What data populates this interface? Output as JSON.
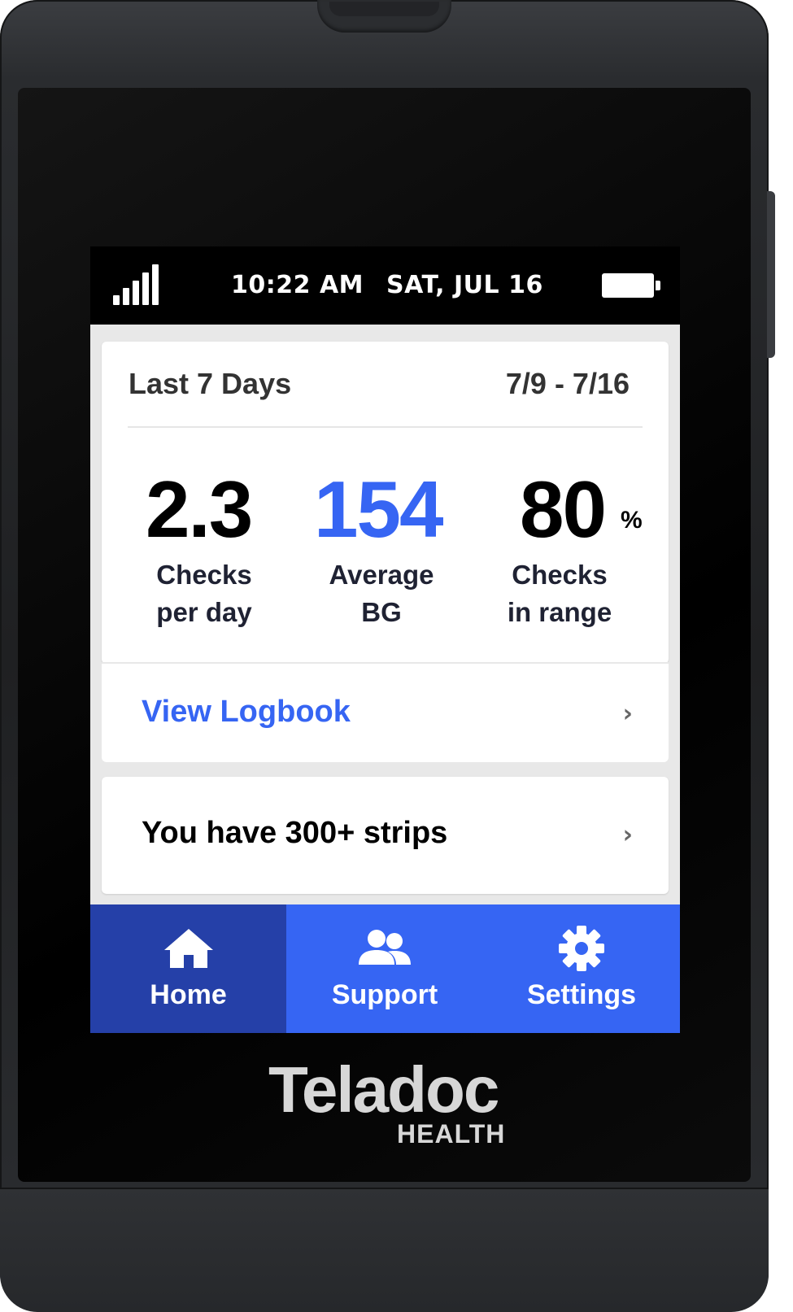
{
  "status_bar": {
    "time": "10:22 AM",
    "date": "SAT, JUL 16",
    "signal_icon": "signal-bars-icon",
    "battery_icon": "battery-full-icon"
  },
  "summary": {
    "period_label": "Last 7 Days",
    "date_range": "7/9 - 7/16",
    "stats": [
      {
        "value": "2.3",
        "label_line1": "Checks",
        "label_line2": "per day",
        "color": "#000000"
      },
      {
        "value": "154",
        "label_line1": "Average",
        "label_line2": "BG",
        "color": "#3665f3"
      },
      {
        "value": "80",
        "unit": "%",
        "label_line1": "Checks",
        "label_line2": "in range",
        "color": "#000000"
      }
    ]
  },
  "logbook": {
    "label": "View Logbook",
    "chevron": "›",
    "color": "#3665f3"
  },
  "strips": {
    "label": "You have 300+ strips",
    "chevron": "›"
  },
  "nav": {
    "items": [
      {
        "label": "Home",
        "icon": "home-icon",
        "active": true
      },
      {
        "label": "Support",
        "icon": "people-icon",
        "active": false
      },
      {
        "label": "Settings",
        "icon": "gear-icon",
        "active": false
      }
    ],
    "active_color": "#2540a8",
    "bar_color": "#3665f3"
  },
  "brand": {
    "name": "Teladoc",
    "sub": "HEALTH"
  }
}
